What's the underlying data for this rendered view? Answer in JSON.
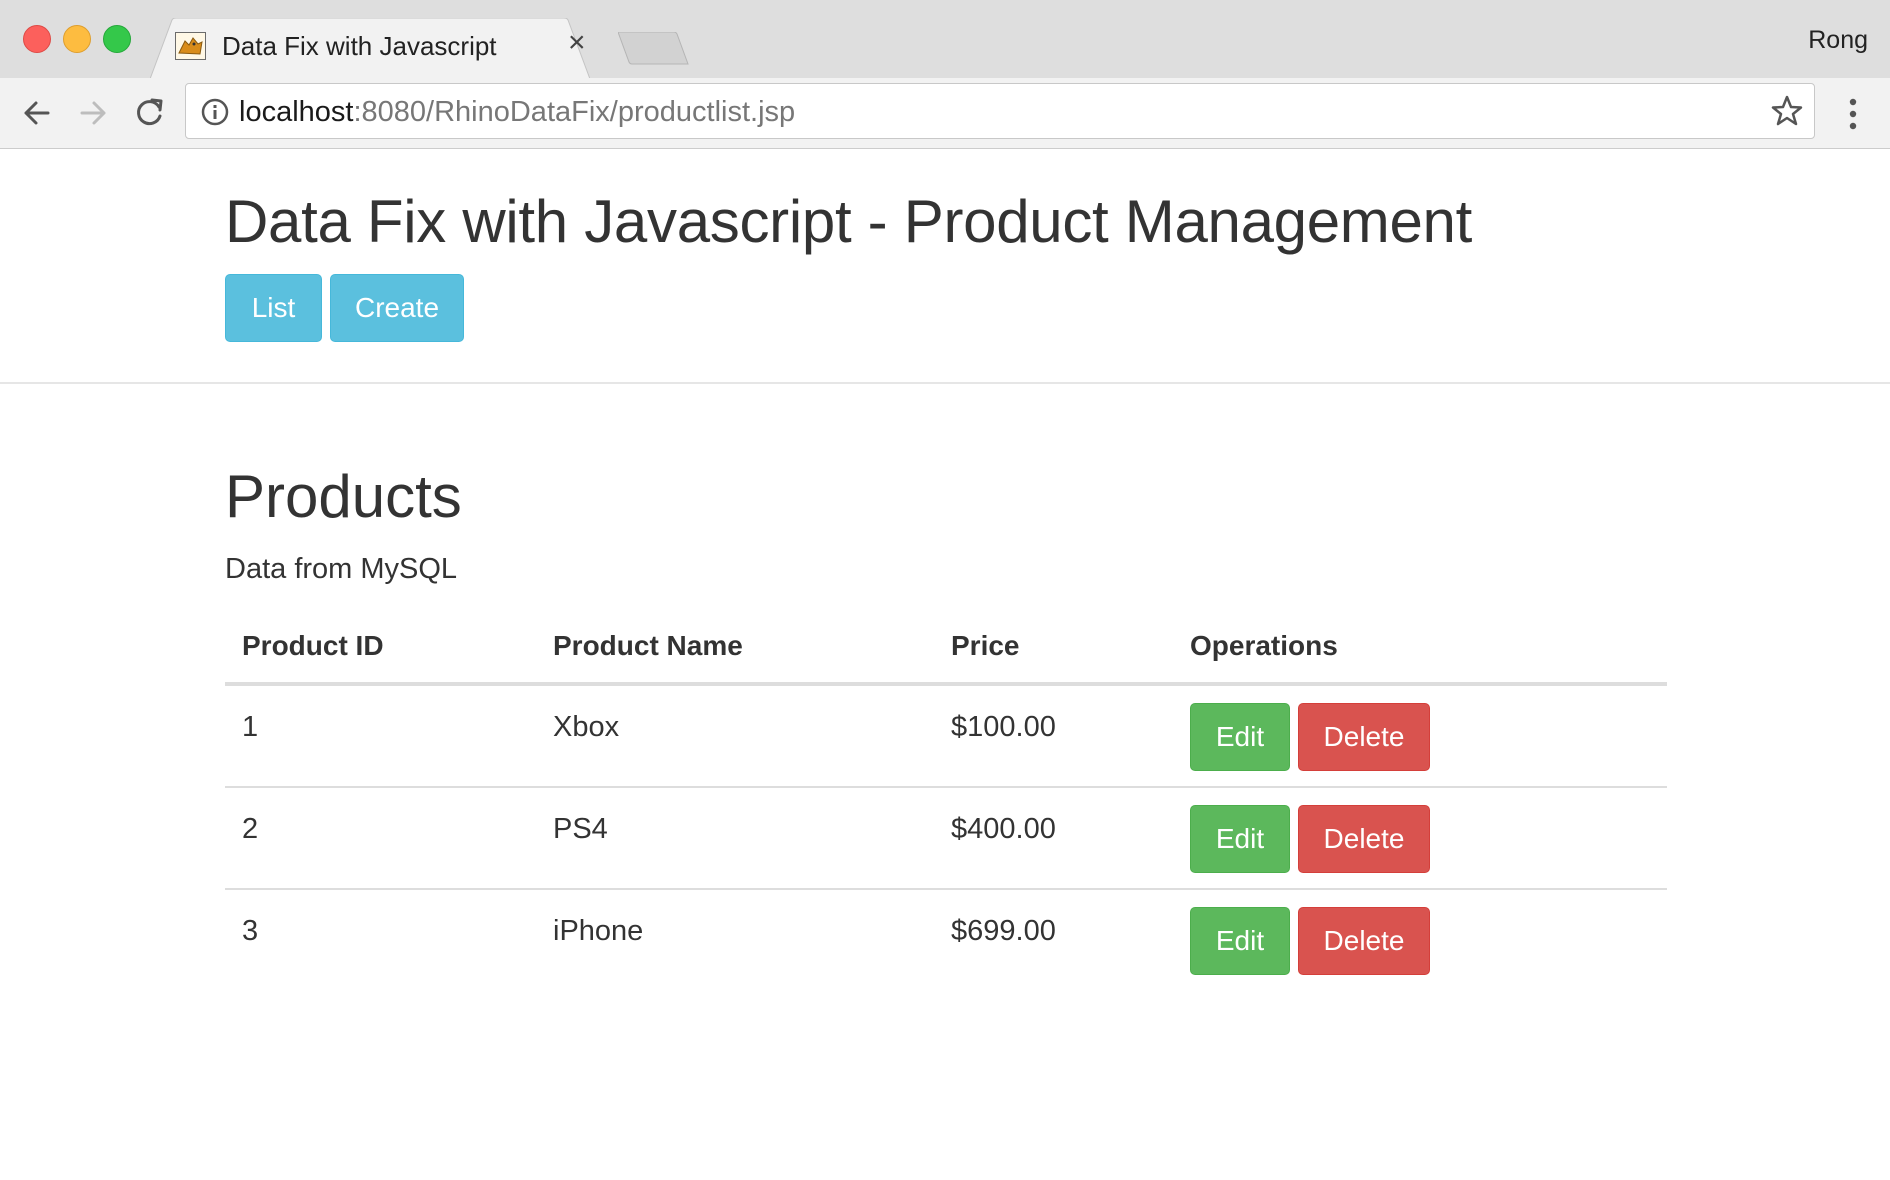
{
  "browser": {
    "tab_title": "Data Fix with Javascript",
    "profile_name": "Rong",
    "url_host": "localhost",
    "url_rest": ":8080/RhinoDataFix/productlist.jsp"
  },
  "page": {
    "title": "Data Fix with Javascript - Product Management",
    "nav": {
      "list_label": "List",
      "create_label": "Create"
    }
  },
  "products": {
    "heading": "Products",
    "subtitle": "Data from MySQL",
    "columns": [
      "Product ID",
      "Product Name",
      "Price",
      "Operations"
    ],
    "rows": [
      {
        "id": "1",
        "name": "Xbox",
        "price": "$100.00"
      },
      {
        "id": "2",
        "name": "PS4",
        "price": "$400.00"
      },
      {
        "id": "3",
        "name": "iPhone",
        "price": "$699.00"
      }
    ],
    "edit_label": "Edit",
    "delete_label": "Delete"
  },
  "colors": {
    "info": "#5bc0de",
    "success": "#5cb85c",
    "danger": "#d9534f",
    "text": "#333333"
  },
  "icons": [
    "back-arrow-icon",
    "forward-arrow-icon",
    "reload-icon",
    "info-icon",
    "star-icon",
    "menu-dots-icon",
    "close-icon",
    "tomcat-favicon-icon"
  ]
}
